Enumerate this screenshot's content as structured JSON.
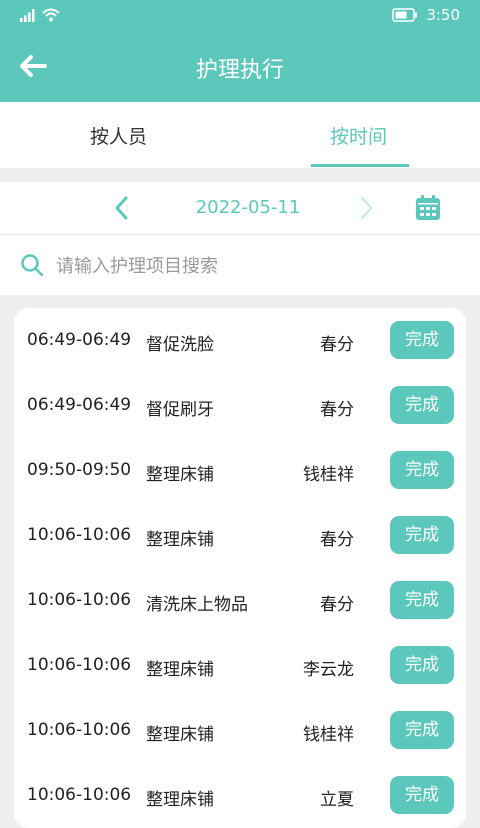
{
  "status": {
    "time": "3:50"
  },
  "header": {
    "title": "护理执行"
  },
  "tabs": [
    {
      "label": "按人员"
    },
    {
      "label": "按时间"
    }
  ],
  "date_nav": {
    "date": "2022-05-11"
  },
  "search": {
    "placeholder": "请输入护理项目搜索",
    "value": ""
  },
  "rows": [
    {
      "time": "06:49-06:49",
      "task": "督促洗脸",
      "person": "春分",
      "action": "完成"
    },
    {
      "time": "06:49-06:49",
      "task": "督促刷牙",
      "person": "春分",
      "action": "完成"
    },
    {
      "time": "09:50-09:50",
      "task": "整理床铺",
      "person": "钱桂祥",
      "action": "完成"
    },
    {
      "time": "10:06-10:06",
      "task": "整理床铺",
      "person": "春分",
      "action": "完成"
    },
    {
      "time": "10:06-10:06",
      "task": "清洗床上物品",
      "person": "春分",
      "action": "完成"
    },
    {
      "time": "10:06-10:06",
      "task": "整理床铺",
      "person": "李云龙",
      "action": "完成"
    },
    {
      "time": "10:06-10:06",
      "task": "整理床铺",
      "person": "钱桂祥",
      "action": "完成"
    },
    {
      "time": "10:06-10:06",
      "task": "整理床铺",
      "person": "立夏",
      "action": "完成"
    }
  ],
  "colors": {
    "accent": "#5cc8bc",
    "background": "#efefef"
  }
}
